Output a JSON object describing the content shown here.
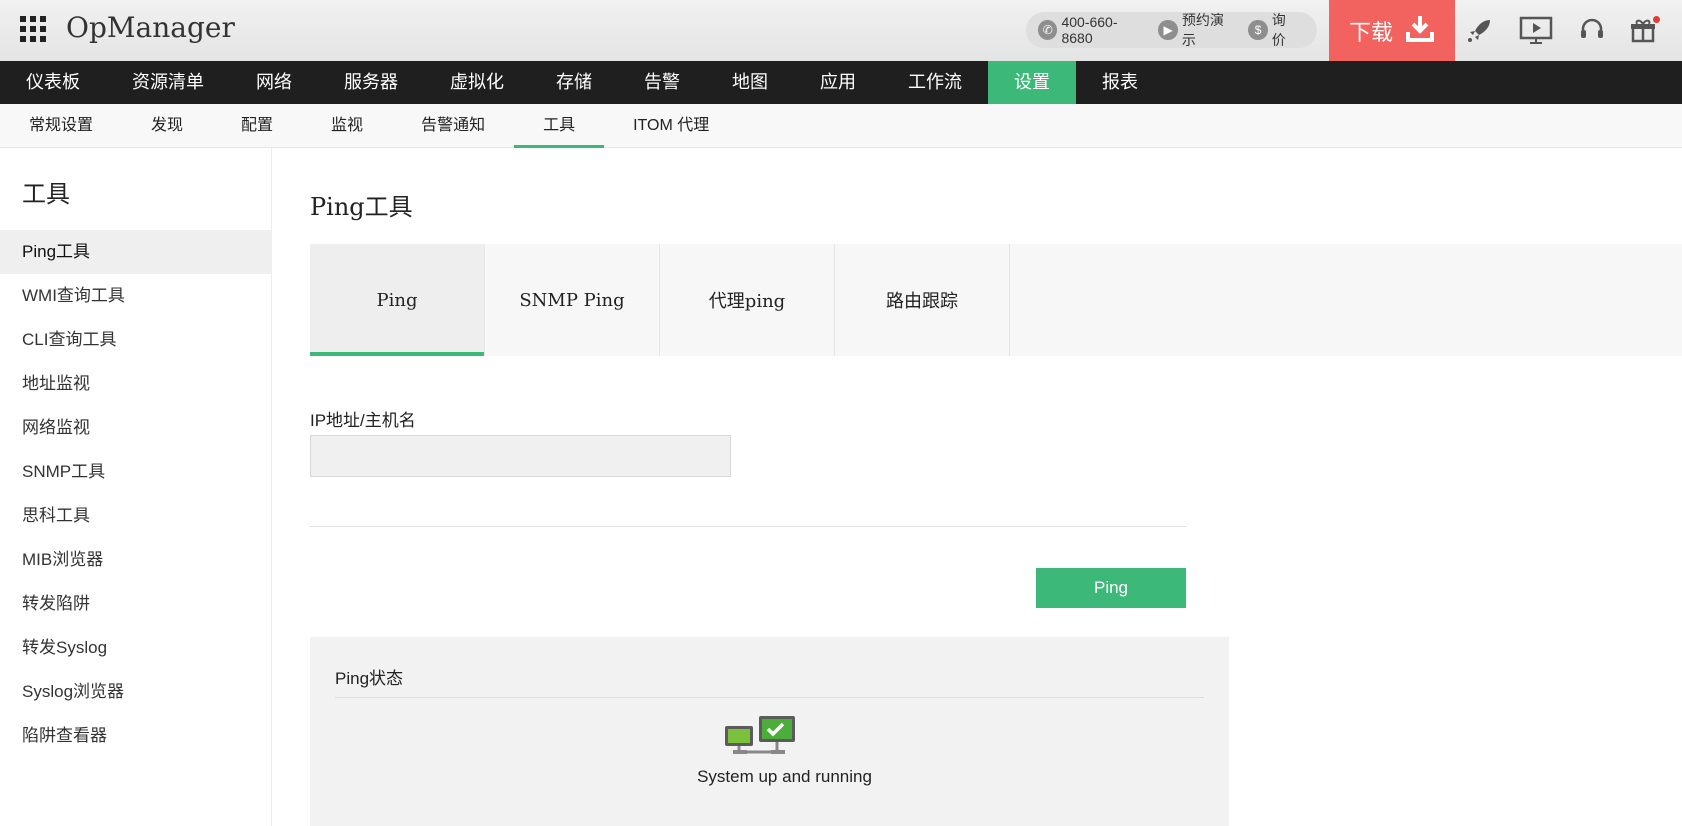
{
  "header": {
    "brand": "OpManager",
    "phone": "400-660-8680",
    "demo_label": "预约演示",
    "pricing_label": "询价",
    "download_label": "下载",
    "icons": [
      "apps-grid-icon",
      "phone-icon",
      "demo-play-icon",
      "dollar-icon",
      "download-arrow-icon",
      "rocket-icon",
      "presentation-icon",
      "headset-icon",
      "gift-icon"
    ]
  },
  "mainnav": {
    "items": [
      "仪表板",
      "资源清单",
      "网络",
      "服务器",
      "虚拟化",
      "存储",
      "告警",
      "地图",
      "应用",
      "工作流",
      "设置",
      "报表"
    ],
    "active": "设置"
  },
  "subnav": {
    "items": [
      "常规设置",
      "发现",
      "配置",
      "监视",
      "告警通知",
      "工具",
      "ITOM 代理"
    ],
    "active": "工具"
  },
  "sidebar": {
    "title": "工具",
    "items": [
      "Ping工具",
      "WMI查询工具",
      "CLI查询工具",
      "地址监视",
      "网络监视",
      "SNMP工具",
      "思科工具",
      "MIB浏览器",
      "转发陷阱",
      "转发Syslog",
      "Syslog浏览器",
      "陷阱查看器"
    ],
    "active": "Ping工具"
  },
  "content": {
    "title": "Ping工具",
    "tabs": [
      "Ping",
      "SNMP Ping",
      "代理ping",
      "路由跟踪"
    ],
    "active_tab": "Ping",
    "field_label": "IP地址/主机名",
    "field_value": "",
    "button_label": "Ping",
    "status_title": "Ping状态",
    "status_message": "System up and running"
  },
  "colors": {
    "accent_green": "#3cb878",
    "download_red": "#f2625f",
    "nav_dark": "#1f1f1f"
  }
}
